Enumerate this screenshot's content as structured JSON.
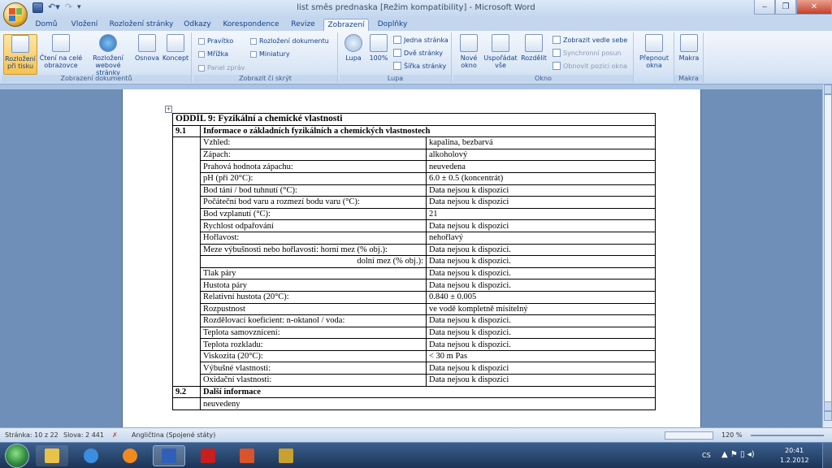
{
  "window": {
    "title": "list směs prednaska [Režim kompatibility] - Microsoft Word"
  },
  "ribbon_tabs": [
    {
      "label": "Domů"
    },
    {
      "label": "Vložení"
    },
    {
      "label": "Rozložení stránky"
    },
    {
      "label": "Odkazy"
    },
    {
      "label": "Korespondence"
    },
    {
      "label": "Revize"
    },
    {
      "label": "Zobrazení",
      "active": true
    },
    {
      "label": "Doplňky"
    }
  ],
  "ribbon": {
    "views": {
      "group_label": "Zobrazení dokumentů",
      "print_layout": "Rozložení při tisku",
      "full_reading": "Čtení na celé obrazovce",
      "web_layout": "Rozložení webové stránky",
      "outline": "Osnova",
      "draft": "Koncept"
    },
    "show_hide": {
      "group_label": "Zobrazit či skrýt",
      "ruler": "Pravítko",
      "gridlines": "Mřížka",
      "message_bar": "Panel zpráv",
      "doc_map": "Rozložení dokumentu",
      "thumbnails": "Miniatury"
    },
    "zoom": {
      "group_label": "Lupa",
      "zoom": "Lupa",
      "hundred": "100%",
      "one_page": "Jedna stránka",
      "two_pages": "Dvě stránky",
      "page_width": "Šířka stránky"
    },
    "window": {
      "group_label": "Okno",
      "new_window": "Nové okno",
      "arrange_all": "Uspořádat vše",
      "split": "Rozdělit",
      "side_by_side": "Zobrazit vedle sebe",
      "sync_scroll": "Synchronní posun",
      "reset_position": "Obnovit pozici okna",
      "switch_windows": "Přepnout okna"
    },
    "macros": {
      "group_label": "Makra",
      "macros": "Makra"
    }
  },
  "document": {
    "section_title": "ODDÍL 9: Fyzikální a chemické vlastnosti",
    "subsection_91_num": "9.1",
    "subsection_91_title": "Informace o základních fyzikálních a chemických vlastnostech",
    "rows": [
      {
        "label": "Vzhled:",
        "value": "kapalina, bezbarvá"
      },
      {
        "label": "Zápach:",
        "value": "alkoholový"
      },
      {
        "label": "Prahová hodnota zápachu:",
        "value": "neuvedena"
      },
      {
        "label": "pH (při 20°C):",
        "value": "6.0 ± 0.5 (koncentrát)"
      },
      {
        "label": "Bod tání / bod tuhnutí (°C):",
        "value": "Data nejsou k dispozici"
      },
      {
        "label": "Počáteční bod varu a rozmezí bodu varu (°C):",
        "value": "Data nejsou k dispozici"
      },
      {
        "label": "Bod vzplanutí (°C):",
        "value": "21"
      },
      {
        "label": "Rychlost odpařování",
        "value": "Data nejsou k dispozici"
      },
      {
        "label": "Hořlavost:",
        "value": "nehořlavý"
      },
      {
        "label": "Meze výbušnosti nebo hořlavosti:      horní mez (% obj.):",
        "value": "Data nejsou k dispozici."
      },
      {
        "label": "dolní mez (% obj.):",
        "value": "Data nejsou k dispozici.",
        "right": true
      },
      {
        "label": "Tlak páry",
        "value": "Data nejsou k dispozici."
      },
      {
        "label": "Hustota páry",
        "value": "Data nejsou k dispozici."
      },
      {
        "label": "Relativní hustota (20°C):",
        "value": "0.840 ± 0.005"
      },
      {
        "label": "Rozpustnost",
        "value": "ve vodě kompletně mísitelný"
      },
      {
        "label": "Rozdělovací koeficient: n-oktanol / voda:",
        "value": "Data nejsou k dispozici."
      },
      {
        "label": "Teplota samovznícení:",
        "value": "Data nejsou k dispozici."
      },
      {
        "label": "Teplota rozkladu:",
        "value": "Data nejsou k dispozici."
      },
      {
        "label": "Viskozita (20°C):",
        "value": "< 30 m Pas"
      },
      {
        "label": "Výbušné vlastnosti:",
        "value": "Data nejsou k dispozici"
      },
      {
        "label": "Oxidační vlastnosti:",
        "value": "Data nejsou k dispozici"
      }
    ],
    "subsection_92_num": "9.2",
    "subsection_92_title": "Další informace",
    "subsection_92_text": "neuvedeny"
  },
  "status": {
    "page": "Stránka: 10 z 22",
    "words": "Slova: 2 441",
    "language": "Angličtina (Spojené státy)",
    "zoom": "120 %"
  },
  "tray": {
    "lang": "CS",
    "time": "20:41",
    "date": "1.2.2012"
  }
}
